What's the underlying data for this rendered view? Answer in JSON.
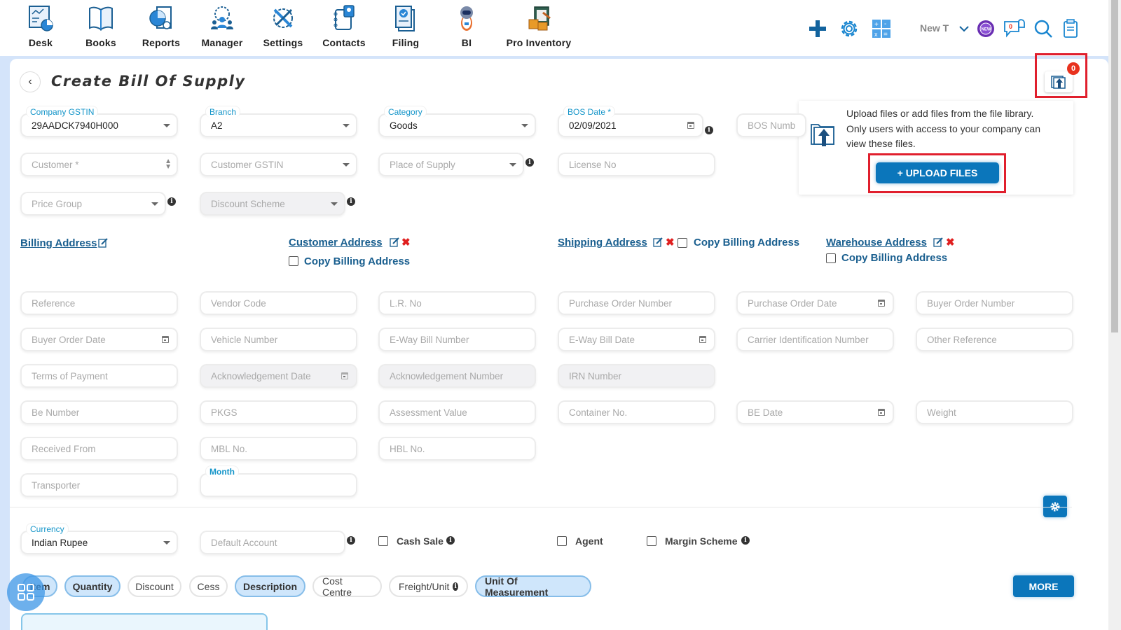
{
  "nav": {
    "items": [
      {
        "label": "Desk",
        "icon": "desk-icon"
      },
      {
        "label": "Books",
        "icon": "books-icon"
      },
      {
        "label": "Reports",
        "icon": "reports-icon"
      },
      {
        "label": "Manager",
        "icon": "manager-icon"
      },
      {
        "label": "Settings",
        "icon": "settings-icon"
      },
      {
        "label": "Contacts",
        "icon": "contacts-icon"
      },
      {
        "label": "Filing",
        "icon": "filing-icon"
      },
      {
        "label": "BI",
        "icon": "bi-robot-icon"
      },
      {
        "label": "Pro Inventory",
        "icon": "pro-inventory-icon"
      }
    ],
    "tools": {
      "new_tab_label": "New T",
      "notification_count": "0"
    }
  },
  "page": {
    "title": "Create Bill Of Supply"
  },
  "attachments": {
    "count": "0",
    "popover_text": "Upload files or add files from the file library. Only users with access to your company can view these files.",
    "upload_button": "+ UPLOAD FILES"
  },
  "header_fields": {
    "company_gstin": {
      "label": "Company GSTIN",
      "value": "29AADCK7940H000"
    },
    "branch": {
      "label": "Branch",
      "value": "A2"
    },
    "category": {
      "label": "Category",
      "value": "Goods"
    },
    "bos_date": {
      "label": "BOS Date *",
      "value": "02/09/2021"
    },
    "bos_number": {
      "placeholder": "BOS Number"
    },
    "customer": {
      "placeholder": "Customer *"
    },
    "customer_gstin": {
      "placeholder": "Customer GSTIN"
    },
    "place_of_supply": {
      "placeholder": "Place of Supply"
    },
    "license_no": {
      "placeholder": "License No"
    },
    "price_group": {
      "placeholder": "Price Group"
    },
    "discount_scheme": {
      "placeholder": "Discount Scheme"
    }
  },
  "addresses": {
    "billing": "Billing Address",
    "customer": "Customer Address",
    "shipping": "Shipping Address",
    "warehouse": "Warehouse Address",
    "copy_billing": "Copy Billing Address"
  },
  "details_fields": {
    "reference": "Reference",
    "vendor_code": "Vendor Code",
    "lr_no": "L.R. No",
    "purchase_order_number": "Purchase Order Number",
    "purchase_order_date": "Purchase Order Date",
    "buyer_order_number": "Buyer Order Number",
    "buyer_order_date": "Buyer Order Date",
    "vehicle_number": "Vehicle Number",
    "eway_bill_number": "E-Way Bill Number",
    "eway_bill_date": "E-Way Bill Date",
    "carrier_id_number": "Carrier Identification Number",
    "other_reference": "Other Reference",
    "terms_of_payment": "Terms of Payment",
    "ack_date": "Acknowledgement Date",
    "ack_number": "Acknowledgement Number",
    "irn_number": "IRN Number",
    "be_number": "Be Number",
    "pkgs": "PKGS",
    "assessment_value": "Assessment Value",
    "container_no": "Container No.",
    "be_date": "BE Date",
    "weight": "Weight",
    "received_from": "Received From",
    "mbl_no": "MBL No.",
    "hbl_no": "HBL No.",
    "transporter": "Transporter",
    "month_label": "Month"
  },
  "footer_fields": {
    "currency": {
      "label": "Currency",
      "value": "Indian Rupee"
    },
    "default_account": {
      "placeholder": "Default Account"
    },
    "cash_sale": "Cash Sale",
    "agent": "Agent",
    "margin_scheme": "Margin Scheme"
  },
  "columns": {
    "pills": [
      {
        "label": "Item",
        "active": true
      },
      {
        "label": "Quantity",
        "active": true
      },
      {
        "label": "Discount",
        "active": false
      },
      {
        "label": "Cess",
        "active": false
      },
      {
        "label": "Description",
        "active": true
      },
      {
        "label": "Cost Centre",
        "active": false
      },
      {
        "label": "Freight/Unit",
        "active": false
      },
      {
        "label": "Unit Of Measurement",
        "active": true
      }
    ],
    "more_button": "MORE"
  },
  "colors": {
    "accent": "#0b76bb",
    "label_blue": "#1595c9",
    "link_blue": "#1a5f8f",
    "highlight_red": "#e01f2d",
    "badge_red": "#e8321e"
  }
}
